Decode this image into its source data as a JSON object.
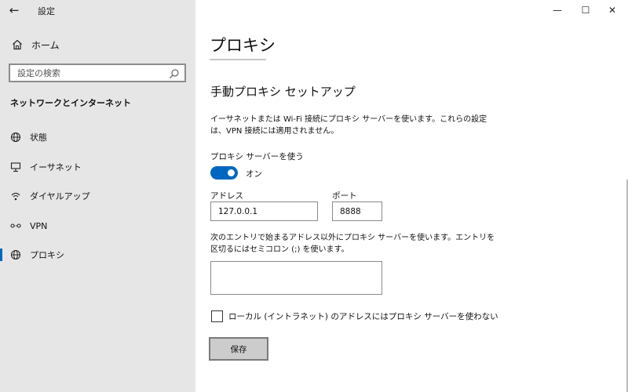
{
  "sidebar": {
    "back_icon": "back-arrow-icon",
    "app_title": "設定",
    "home": {
      "label": "ホーム",
      "icon": "home-icon"
    },
    "search": {
      "placeholder": "設定の検索",
      "icon": "search-icon"
    },
    "section_title": "ネットワークとインターネット",
    "items": [
      {
        "label": "状態",
        "icon": "globe-status-icon"
      },
      {
        "label": "イーサネット",
        "icon": "ethernet-icon"
      },
      {
        "label": "ダイヤルアップ",
        "icon": "dialup-icon"
      },
      {
        "label": "VPN",
        "icon": "vpn-icon"
      },
      {
        "label": "プロキシ",
        "icon": "globe-icon",
        "active": true
      }
    ]
  },
  "window": {
    "minimize": "—",
    "maximize": "☐",
    "close": "✕"
  },
  "main": {
    "title": "プロキシ",
    "manual_setup": {
      "heading": "手動プロキシ セットアップ",
      "description": "イーサネットまたは Wi-Fi 接続にプロキシ サーバーを使います。これらの設定は、VPN 接続には適用されません。",
      "use_proxy_label": "プロキシ サーバーを使う",
      "toggle_state": "オン",
      "toggle_on": true,
      "address_label": "アドレス",
      "address_value": "127.0.0.1",
      "port_label": "ポート",
      "port_value": "8888",
      "exceptions_label": "次のエントリで始まるアドレス以外にプロキシ サーバーを使います。エントリを区切るにはセミコロン (;) を使います。",
      "exceptions_value": "",
      "local_bypass_label": "ローカル (イントラネット) のアドレスにはプロキシ サーバーを使わない",
      "local_bypass_checked": false,
      "save_label": "保存"
    }
  },
  "colors": {
    "accent": "#0067c0",
    "sidebar_bg": "#e6e6e6"
  }
}
